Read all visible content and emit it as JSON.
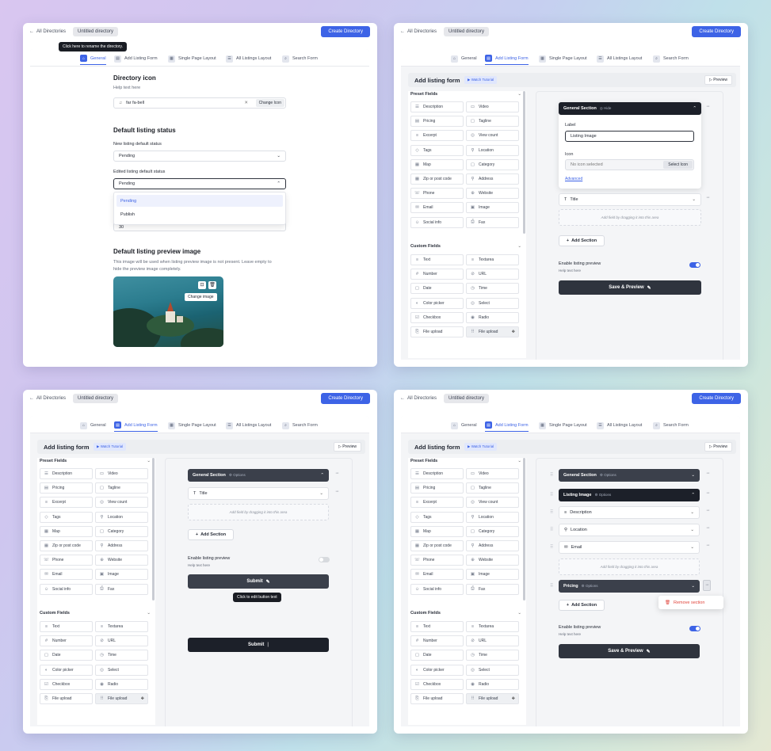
{
  "common": {
    "back_label": "All Directories",
    "directory_name": "Untitled directory",
    "create_label": "Create Directory",
    "tabs": [
      "General",
      "Add Listing Form",
      "Single Page Layout",
      "All Listings Layout",
      "Search Form"
    ]
  },
  "w1": {
    "tooltip": "Click here to rename the directory.",
    "icon_title": "Directory icon",
    "icon_help": "Help text here",
    "icon_value": "far fa-bell",
    "change_icon": "Change Icon",
    "status_title": "Default listing status",
    "new_label": "New listing default status",
    "new_value": "Pending",
    "edited_label": "Edited listing default status",
    "edited_value": "Pending",
    "options": [
      "Pending",
      "Publish"
    ],
    "number_value": "30",
    "preview_title": "Default listing preview image",
    "preview_desc1": "This image will be used when listing preview image is not present. Leave empty to",
    "preview_desc2": "hide the preview image completely.",
    "change_image": "Change image"
  },
  "form": {
    "title": "Add listing form",
    "watch": "Watch Tutorial",
    "preview": "Preview",
    "preset": "Preset Fields",
    "custom": "Custom Fields",
    "preset_fields": [
      [
        "Description",
        "Video"
      ],
      [
        "Pricing",
        "Tagline"
      ],
      [
        "Excerpt",
        "View count"
      ],
      [
        "Tags",
        "Location"
      ],
      [
        "Map",
        "Category"
      ],
      [
        "Zip or post code",
        "Address"
      ],
      [
        "Phone",
        "Website"
      ],
      [
        "Email",
        "Image"
      ],
      [
        "Social info",
        "Fax"
      ]
    ],
    "custom_fields": [
      [
        "Text",
        "Textarea"
      ],
      [
        "Number",
        "URL"
      ],
      [
        "Date",
        "Time"
      ],
      [
        "Color picker",
        "Select"
      ],
      [
        "Checkbox",
        "Radio"
      ],
      [
        "File upload",
        "File upload"
      ]
    ],
    "add_section": "Add Section",
    "drop_text": "Add field by dragging it into this area",
    "enable_preview": "Enable listing preview",
    "help_text": "Help text here",
    "save_preview": "Save & Preview",
    "options": "Options"
  },
  "w2": {
    "section": "General Section",
    "hide": "Hide",
    "label_label": "Label",
    "label_value": "Listing Image",
    "icon_label": "Icon",
    "icon_placeholder": "No icon selected",
    "select_icon": "Select Icon",
    "advanced": "Advanced",
    "title_field": "Title"
  },
  "w3": {
    "section": "General Section",
    "title_field": "Title",
    "submit": "Submit",
    "tooltip": "Click to edit button text",
    "submit_edit": "Submit"
  },
  "w4": {
    "sections": [
      "General Section",
      "Listing Image",
      "Pricing"
    ],
    "fields": [
      "Description",
      "Location",
      "Email"
    ],
    "remove": "Remove section"
  }
}
